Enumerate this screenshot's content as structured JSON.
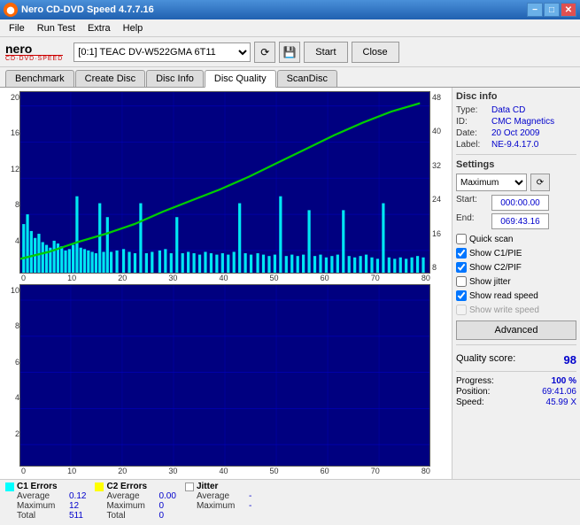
{
  "titleBar": {
    "title": "Nero CD-DVD Speed 4.7.7.16",
    "minBtn": "−",
    "maxBtn": "□",
    "closeBtn": "✕"
  },
  "menu": {
    "items": [
      "File",
      "Run Test",
      "Extra",
      "Help"
    ]
  },
  "toolbar": {
    "driveLabel": "[0:1]  TEAC DV-W522GMA 6T11",
    "startBtn": "Start",
    "closeBtn": "Close"
  },
  "tabs": [
    {
      "label": "Benchmark"
    },
    {
      "label": "Create Disc"
    },
    {
      "label": "Disc Info"
    },
    {
      "label": "Disc Quality",
      "active": true
    },
    {
      "label": "ScanDisc"
    }
  ],
  "discInfo": {
    "sectionTitle": "Disc info",
    "typeLabel": "Type:",
    "typeValue": "Data CD",
    "idLabel": "ID:",
    "idValue": "CMC Magnetics",
    "dateLabel": "Date:",
    "dateValue": "20 Oct 2009",
    "labelLabel": "Label:",
    "labelValue": "NE-9.4.17.0"
  },
  "settings": {
    "sectionTitle": "Settings",
    "speedOption": "Maximum",
    "startLabel": "Start:",
    "startValue": "000:00.00",
    "endLabel": "End:",
    "endValue": "069:43.16",
    "quickScan": "Quick scan",
    "showC1PIE": "Show C1/PIE",
    "showC2PIF": "Show C2/PIF",
    "showJitter": "Show jitter",
    "showReadSpeed": "Show read speed",
    "showWriteSpeed": "Show write speed",
    "advancedBtn": "Advanced"
  },
  "quality": {
    "label": "Quality score:",
    "score": "98"
  },
  "chart1": {
    "yAxisLeft": [
      "20",
      "16",
      "12",
      "8",
      "4"
    ],
    "yAxisRight": [
      "48",
      "40",
      "32",
      "24",
      "16",
      "8"
    ],
    "xAxis": [
      "0",
      "10",
      "20",
      "30",
      "40",
      "50",
      "60",
      "70",
      "80"
    ]
  },
  "chart2": {
    "yAxisLeft": [
      "10",
      "8",
      "6",
      "4",
      "2"
    ],
    "xAxis": [
      "0",
      "10",
      "20",
      "30",
      "40",
      "50",
      "60",
      "70",
      "80"
    ]
  },
  "stats": {
    "c1": {
      "label": "C1 Errors",
      "averageLabel": "Average",
      "averageValue": "0.12",
      "maximumLabel": "Maximum",
      "maximumValue": "12",
      "totalLabel": "Total",
      "totalValue": "511",
      "color": "#00ffff",
      "borderColor": "#00ffff"
    },
    "c2": {
      "label": "C2 Errors",
      "averageLabel": "Average",
      "averageValue": "0.00",
      "maximumLabel": "Maximum",
      "maximumValue": "0",
      "totalLabel": "Total",
      "totalValue": "0",
      "color": "#ffff00",
      "borderColor": "#ffff00"
    },
    "jitter": {
      "label": "Jitter",
      "averageLabel": "Average",
      "averageValue": "-",
      "maximumLabel": "Maximum",
      "maximumValue": "-",
      "color": "#ffffff",
      "borderColor": "#999999"
    }
  },
  "rightStats": {
    "progressLabel": "Progress:",
    "progressValue": "100 %",
    "positionLabel": "Position:",
    "positionValue": "69:41.06",
    "speedLabel": "Speed:",
    "speedValue": "45.99 X"
  }
}
